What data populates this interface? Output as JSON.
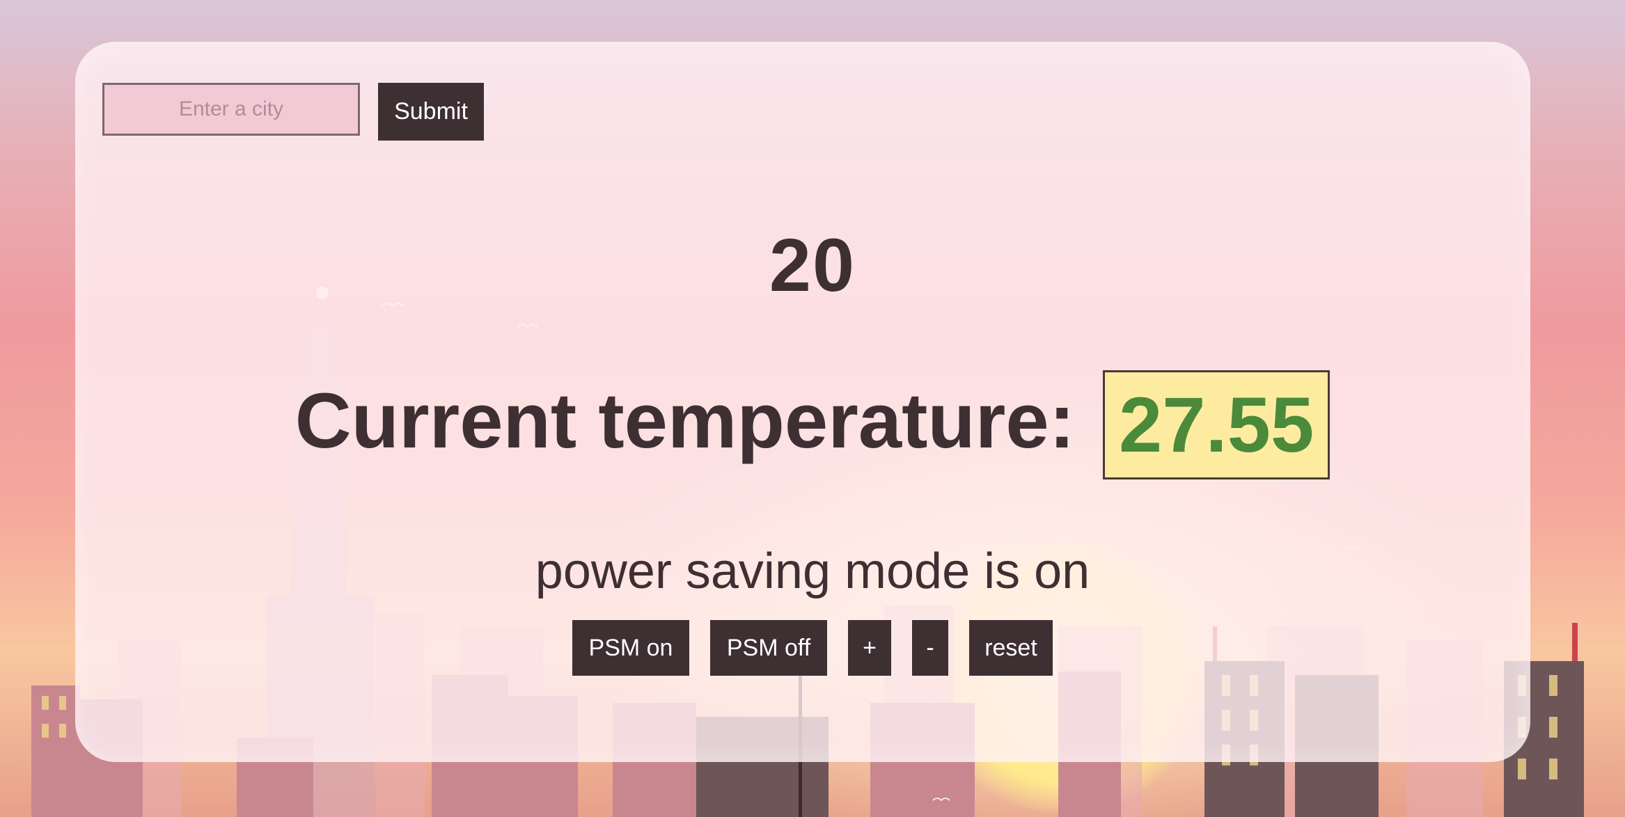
{
  "search": {
    "placeholder": "Enter a city",
    "value": "",
    "submit_label": "Submit"
  },
  "target_temperature": "20",
  "current": {
    "label": "Current temperature:",
    "value": "27.55"
  },
  "psm_status": "power saving mode is on",
  "controls": {
    "psm_on": "PSM on",
    "psm_off": "PSM off",
    "increase": "+",
    "decrease": "-",
    "reset": "reset"
  },
  "colors": {
    "button_bg": "#3e2f33",
    "text": "#3d2f32",
    "temp_value_green": "#4a8a3a",
    "temp_value_bg": "#fdeca0",
    "input_bg": "#f4c9d6"
  }
}
